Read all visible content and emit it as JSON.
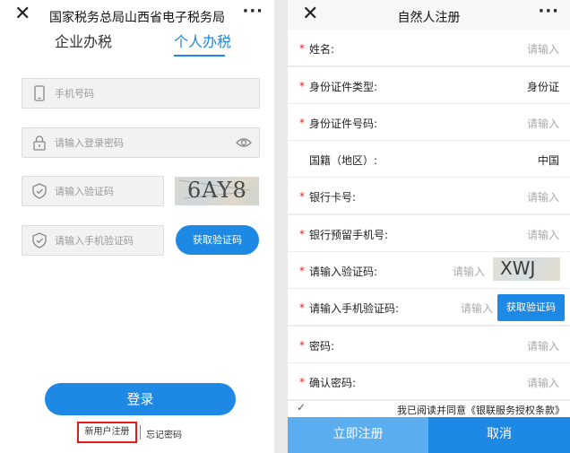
{
  "left": {
    "header": {
      "close": "✕",
      "title": "国家税务总局山西省电子税务局",
      "more": "···"
    },
    "tabs": [
      {
        "label": "企业办税"
      },
      {
        "label": "个人办税"
      }
    ],
    "phone_placeholder": "手机号码",
    "password_placeholder": "请输入登录密码",
    "captcha_placeholder": "请输入验证码",
    "captcha_text": "6AY8",
    "sms_placeholder": "请输入手机验证码",
    "get_code_label": "获取验证码",
    "login_label": "登录",
    "register_label": "新用户注册",
    "forgot_label": "忘记密码"
  },
  "right": {
    "header": {
      "close": "✕",
      "title": "自然人注册",
      "more": "···"
    },
    "rows": [
      {
        "label": "姓名:",
        "value": "请输入"
      },
      {
        "label": "身份证件类型:",
        "value": "身份证"
      },
      {
        "label": "身份证件号码:",
        "value": "请输入"
      },
      {
        "label": "国籍（地区）:",
        "value": "中国"
      },
      {
        "label": "银行卡号:",
        "value": "请输入"
      },
      {
        "label": "银行预留手机号:",
        "value": "请输入"
      },
      {
        "label": "请输入验证码:",
        "value": "请输入"
      },
      {
        "label": "请输入手机验证码:",
        "value": "请输入"
      },
      {
        "label": "密码:",
        "value": "请输入"
      },
      {
        "label": "确认密码:",
        "value": "请输入"
      }
    ],
    "captcha_text": "XWJ",
    "sms_button_label": "获取验证码",
    "agree_check": "✓",
    "agree_text": "我已阅读并同意《银联服务授权条款》",
    "submit_label": "立即注册",
    "cancel_label": "取消"
  },
  "colors": {
    "accent": "#1e88e5",
    "required": "#e02020",
    "highlight": "#e21b1b"
  }
}
